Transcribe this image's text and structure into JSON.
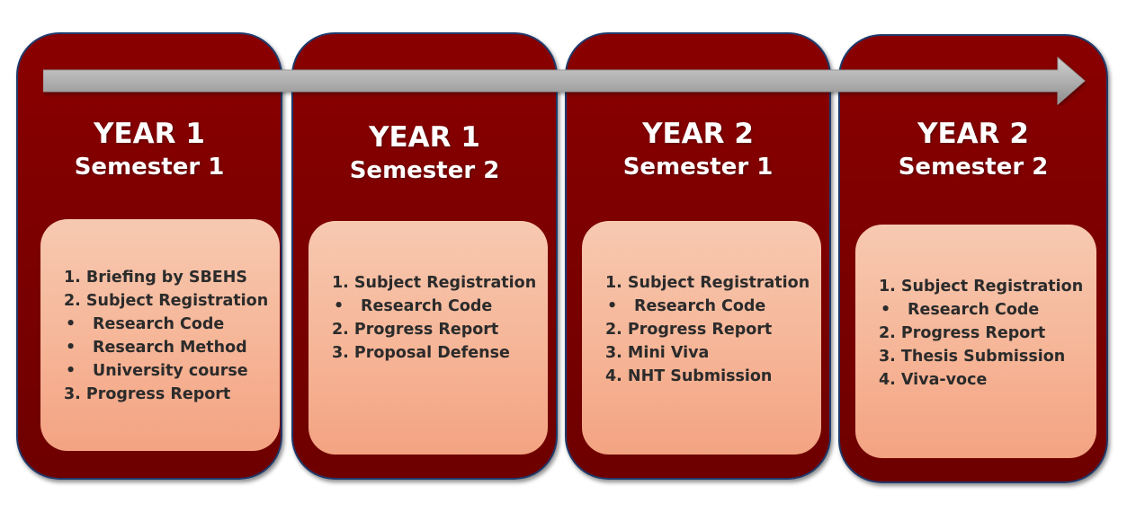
{
  "colors": {
    "panel": "#7a0000",
    "panel_border": "#1f3a6b",
    "box": "#f6b597",
    "arrow": "#b3b3b3",
    "heading_text": "#ffffff",
    "box_text": "#2b2b2b"
  },
  "panels": [
    {
      "year": "YEAR 1",
      "semester": "Semester 1",
      "items": [
        {
          "marker": "1.",
          "text": "Briefing by SBEHS"
        },
        {
          "marker": "2.",
          "text": "Subject Registration"
        },
        {
          "marker": "•",
          "text": "Research Code"
        },
        {
          "marker": "•",
          "text": "Research Method"
        },
        {
          "marker": "•",
          "text": "University course"
        },
        {
          "marker": "3.",
          "text": "Progress Report"
        }
      ]
    },
    {
      "year": "YEAR 1",
      "semester": "Semester 2",
      "items": [
        {
          "marker": "1.",
          "text": "Subject Registration"
        },
        {
          "marker": "•",
          "text": "Research Code"
        },
        {
          "marker": "2.",
          "text": "Progress Report"
        },
        {
          "marker": "3.",
          "text": "Proposal Defense"
        }
      ]
    },
    {
      "year": "YEAR 2",
      "semester": "Semester 1",
      "items": [
        {
          "marker": "1.",
          "text": "Subject Registration"
        },
        {
          "marker": "•",
          "text": "Research Code"
        },
        {
          "marker": "2.",
          "text": "Progress Report"
        },
        {
          "marker": "3.",
          "text": "Mini Viva"
        },
        {
          "marker": "4.",
          "text": "NHT Submission"
        }
      ]
    },
    {
      "year": "YEAR 2",
      "semester": "Semester 2",
      "items": [
        {
          "marker": "1.",
          "text": "Subject Registration"
        },
        {
          "marker": "•",
          "text": "Research Code"
        },
        {
          "marker": "2.",
          "text": "Progress Report"
        },
        {
          "marker": "3.",
          "text": "Thesis Submission"
        },
        {
          "marker": "4.",
          "text": "Viva-voce"
        }
      ]
    }
  ]
}
